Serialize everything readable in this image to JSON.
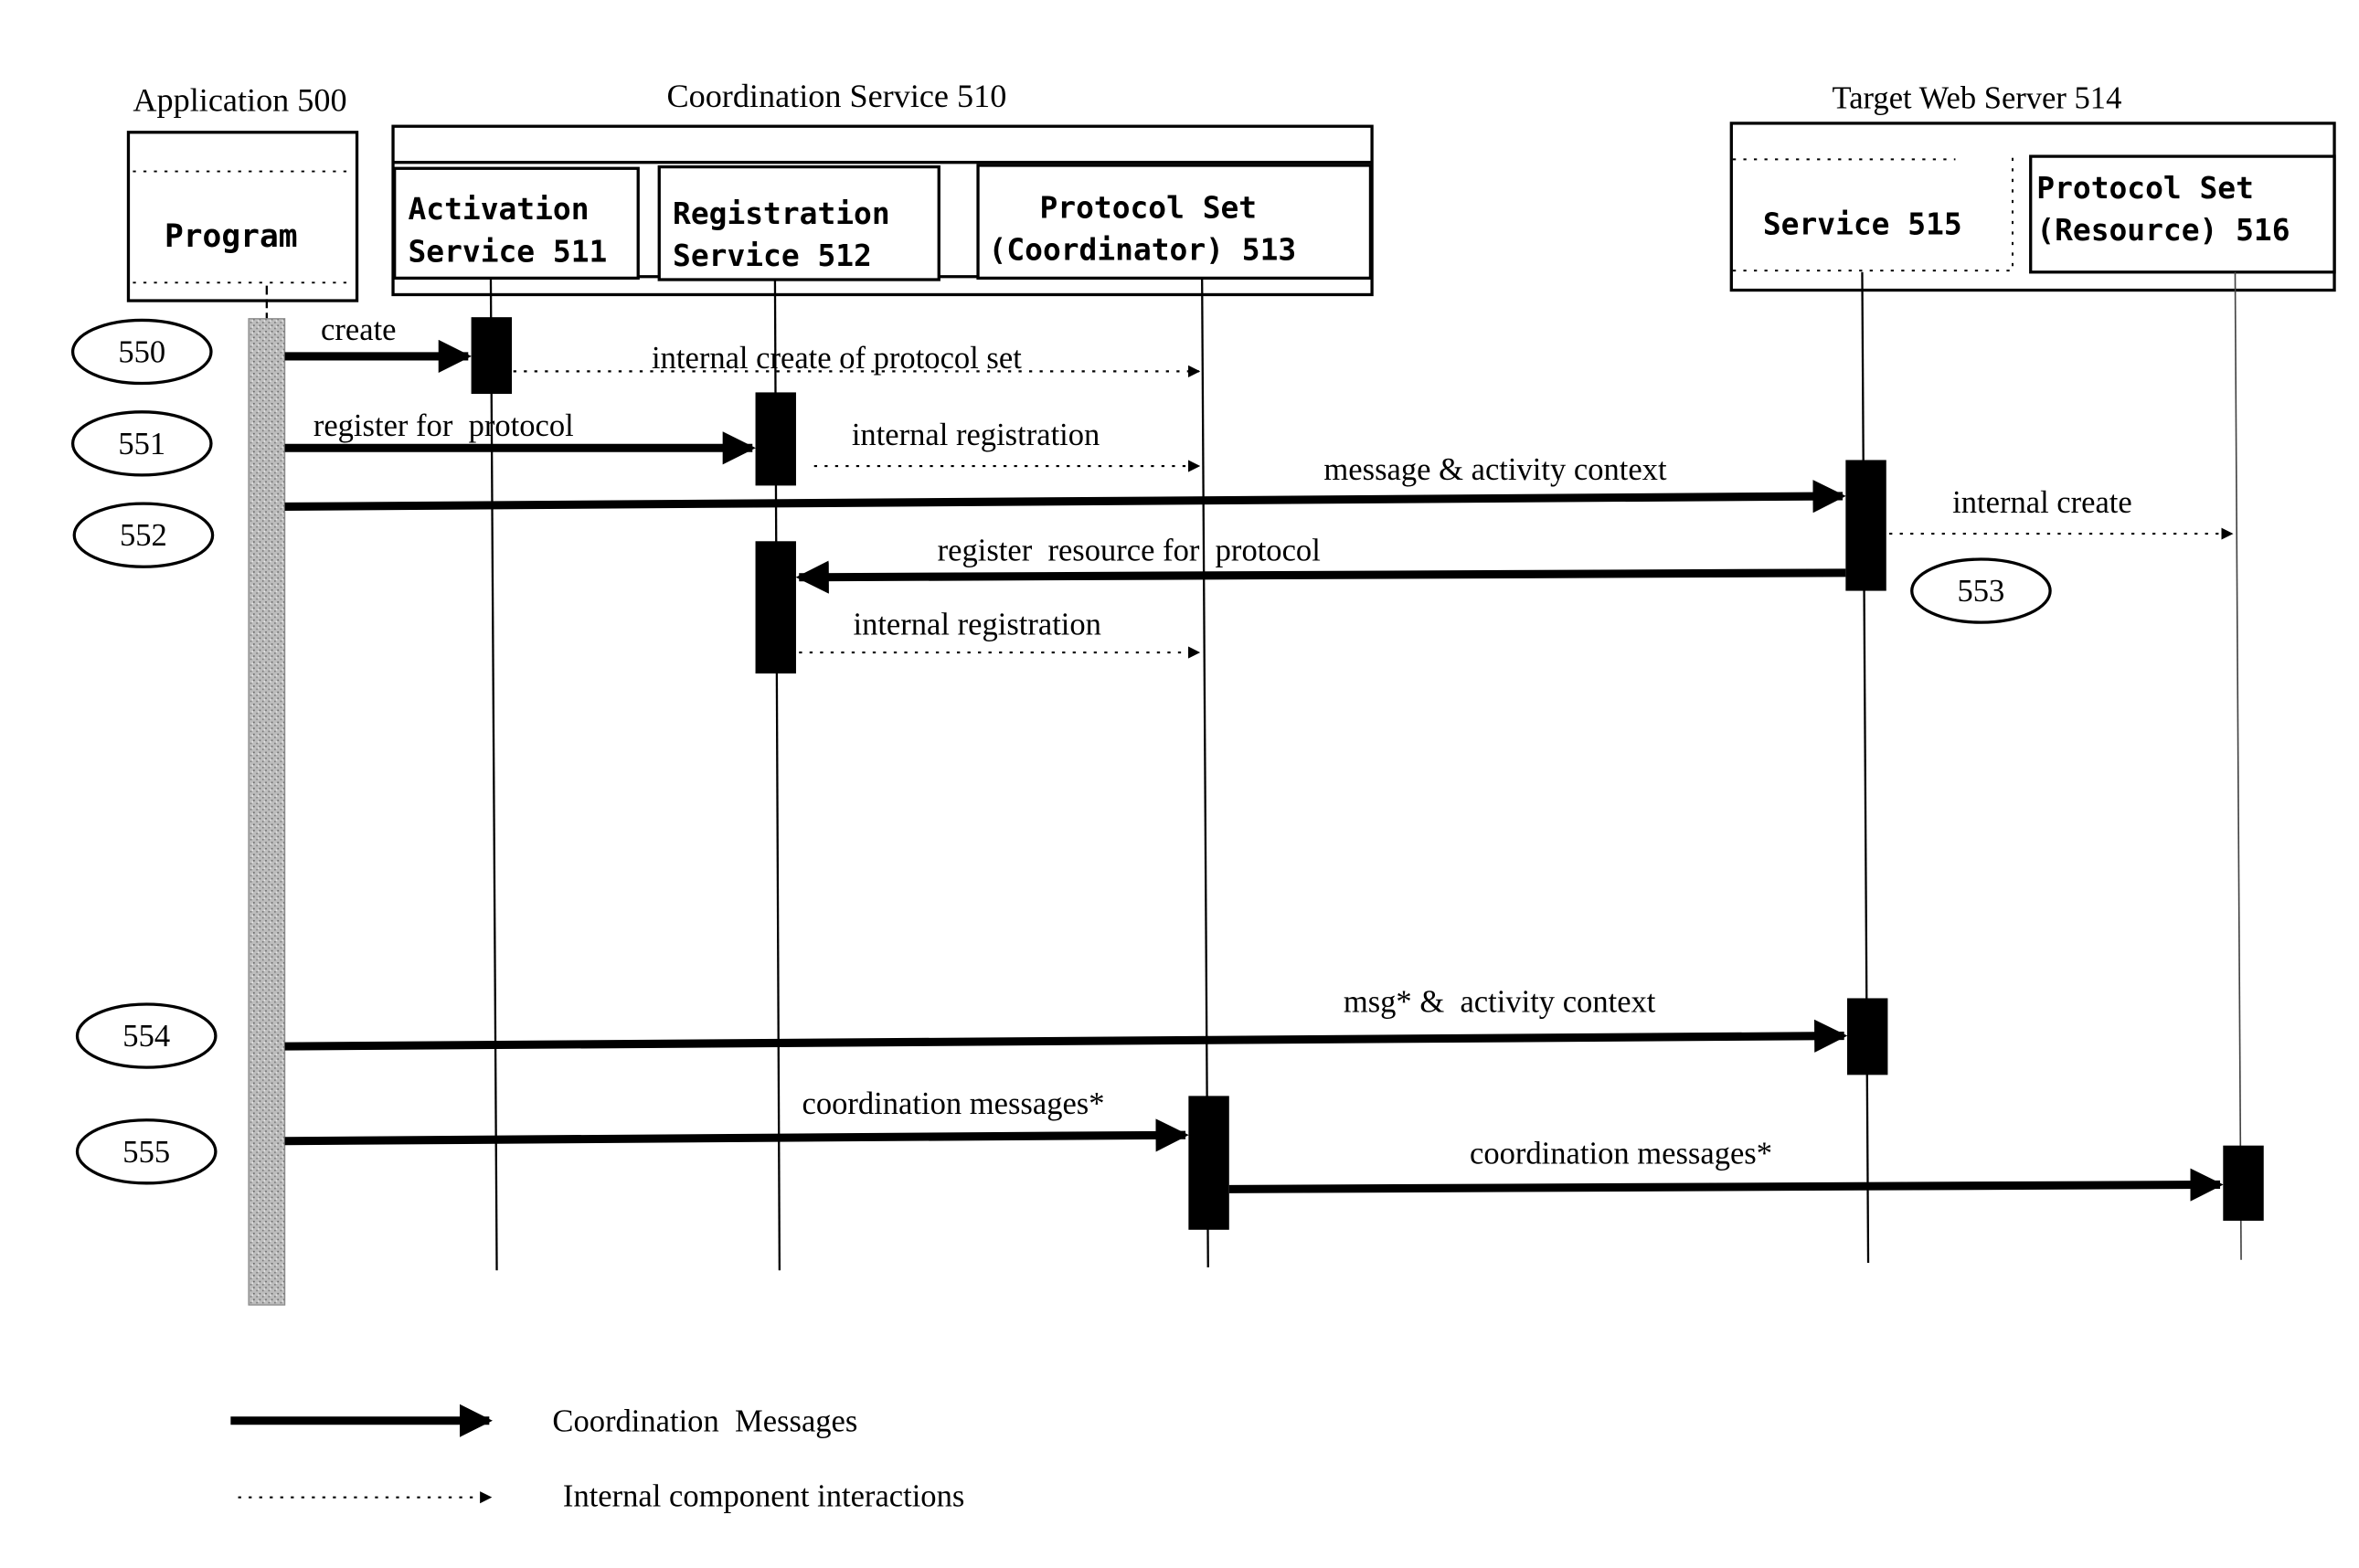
{
  "groups": {
    "application": "Application 500",
    "coordination_service": "Coordination Service 510",
    "target_web_server": "Target Web Server 514"
  },
  "participants": {
    "program": [
      "Program"
    ],
    "activation_service": [
      "Activation",
      "Service 511"
    ],
    "registration_service": [
      "Registration",
      "Service 512"
    ],
    "protocol_set_coordinator": [
      "Protocol Set",
      "(Coordinator) 513"
    ],
    "service_515": [
      "Service 515"
    ],
    "protocol_set_resource": [
      "Protocol Set",
      "(Resource) 516"
    ]
  },
  "steps": {
    "s550": "550",
    "s551": "551",
    "s552": "552",
    "s553": "553",
    "s554": "554",
    "s555": "555"
  },
  "messages": {
    "create": "create",
    "internal_create_protocol_set": "internal create of protocol set",
    "register_for_protocol": "register for  protocol",
    "internal_registration_1": "internal registration",
    "message_activity_context": "message & activity context",
    "internal_create": "internal create",
    "register_resource_for_protocol": "register  resource for  protocol",
    "internal_registration_2": "internal registration",
    "msg_activity_context": "msg* &  activity context",
    "coordination_messages_1": "coordination messages*",
    "coordination_messages_2": "coordination messages*"
  },
  "legend": {
    "coordination_messages": "Coordination  Messages",
    "internal_interactions": "Internal component interactions"
  }
}
